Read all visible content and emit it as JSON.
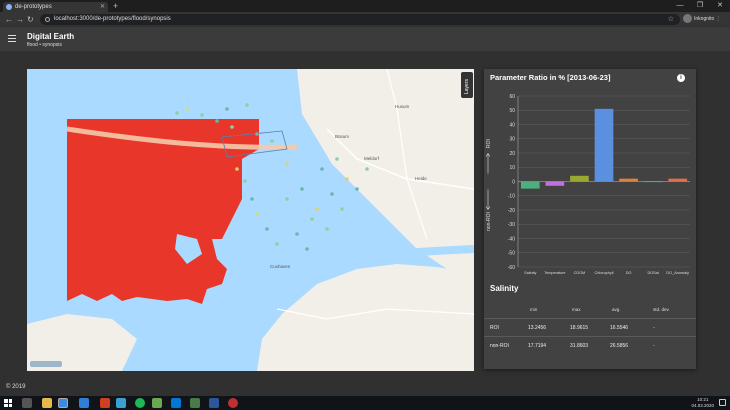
{
  "browser": {
    "tab_title": "de-prototypes",
    "url": "localhost:3000/de-prototypes/flood/synopsis",
    "profile_label": "Inkognito"
  },
  "app": {
    "title": "Digital Earth",
    "breadcrumb_1": "flood",
    "breadcrumb_sep": "•",
    "breadcrumb_2": "synopsis"
  },
  "map": {
    "layers_label": "Layers",
    "places": [
      "Husum",
      "Büsum",
      "Meldorf",
      "Cuxhaven",
      "Heide"
    ]
  },
  "chart_data": {
    "type": "bar",
    "title": "Parameter Ratio in % [2013-06-23]",
    "categories": [
      "Salinity",
      "Temperature",
      "CDOM",
      "Chlorophyll",
      "DO",
      "DOSat",
      "DO_Anomaly"
    ],
    "values": [
      -5,
      -3,
      4,
      51,
      2,
      0,
      2
    ],
    "colors": [
      "#4caf7d",
      "#c070e0",
      "#9aa830",
      "#5b8fe0",
      "#e0803a",
      "#3ac0c0",
      "#e0704a"
    ],
    "ylim": [
      -60,
      60
    ],
    "yticks": [
      -60,
      -50,
      -40,
      -30,
      -20,
      -10,
      0,
      10,
      20,
      30,
      40,
      50,
      60
    ],
    "roi_label": "ROI",
    "nonroi_label": "non-ROI",
    "grid": true
  },
  "salinity": {
    "title": "Salinity",
    "headers": [
      "min",
      "max",
      "avg.",
      "std. dev."
    ],
    "rows": [
      {
        "label": "ROI",
        "min": "13.2456",
        "max": "18.9615",
        "avg": "16.5546",
        "std": "-"
      },
      {
        "label": "non-ROI",
        "min": "17.7194",
        "max": "31.8603",
        "avg": "26.5856",
        "std": "-"
      }
    ]
  },
  "footer": {
    "text": "© 2019"
  },
  "taskbar": {
    "time": "10:21",
    "date": "04.03.2020"
  },
  "colors": {
    "appbar": "#3b3b3b",
    "panel": "#424242",
    "water": "#aadaff",
    "roi": "#e8372a"
  }
}
